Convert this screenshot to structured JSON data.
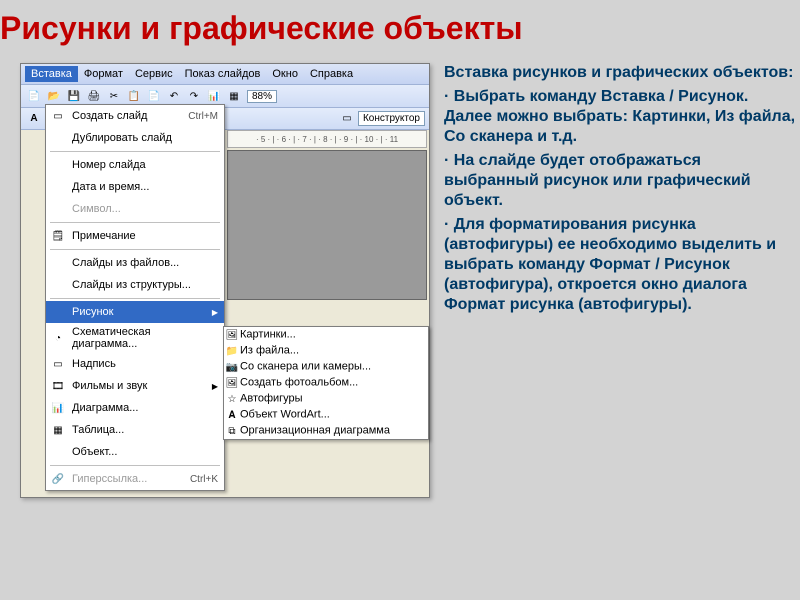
{
  "title": "Рисунки и графические объекты",
  "menubar": {
    "items": [
      "Вставка",
      "Формат",
      "Сервис",
      "Показ слайдов",
      "Окно",
      "Справка"
    ],
    "active": "Вставка"
  },
  "toolbar": {
    "zoom": "88%",
    "konstruktor": "Конструктор"
  },
  "ruler": "· 5 · | · 6 · | · 7 · | · 8 · | · 9 · | · 10 · | · 11",
  "menu": {
    "items": [
      {
        "label": "Создать слайд",
        "shortcut": "Ctrl+M",
        "icon": "new-slide-icon"
      },
      {
        "label": "Дублировать слайд"
      },
      {
        "sep": true
      },
      {
        "label": "Номер слайда"
      },
      {
        "label": "Дата и время..."
      },
      {
        "label": "Символ...",
        "disabled": true
      },
      {
        "sep": true
      },
      {
        "label": "Примечание",
        "icon": "note-icon"
      },
      {
        "sep": true
      },
      {
        "label": "Слайды из файлов..."
      },
      {
        "label": "Слайды из структуры..."
      },
      {
        "sep": true
      },
      {
        "label": "Рисунок",
        "highlight": true,
        "arrow": true
      },
      {
        "label": "Схематическая диаграмма...",
        "icon": "diagram-icon"
      },
      {
        "label": "Надпись",
        "icon": "textbox-icon"
      },
      {
        "label": "Фильмы и звук",
        "arrow": true,
        "icon": "media-icon"
      },
      {
        "label": "Диаграмма...",
        "icon": "chart-icon"
      },
      {
        "label": "Таблица...",
        "icon": "table-icon"
      },
      {
        "label": "Объект..."
      },
      {
        "sep": true
      },
      {
        "label": "Гиперссылка...",
        "shortcut": "Ctrl+K",
        "disabled": true,
        "icon": "link-icon"
      }
    ]
  },
  "submenu": {
    "items": [
      {
        "label": "Картинки...",
        "icon": "clipart-icon"
      },
      {
        "label": "Из файла...",
        "highlight": true,
        "icon": "from-file-icon"
      },
      {
        "label": "Со сканера или камеры...",
        "icon": "scanner-icon"
      },
      {
        "label": "Создать фотоальбом...",
        "icon": "photoalbum-icon"
      },
      {
        "sep": true
      },
      {
        "label": "Автофигуры",
        "icon": "autofig-icon"
      },
      {
        "label": "Объект WordArt...",
        "icon": "wordart-icon"
      },
      {
        "label": "Организационная диаграмма",
        "icon": "orgchart-icon"
      }
    ]
  },
  "description": {
    "heading": "Вставка рисунков и графических объектов:",
    "bullets": [
      "·  Выбрать команду Вставка / Рисунок. Далее можно выбрать: Картинки, Из файла, Со сканера и т.д.",
      "·  На слайде будет отображаться выбранный рисунок или графический объект.",
      "·   Для форматирования рисунка (автофигуры) ее необходимо выделить и выбрать команду Формат / Рисунок (автофигура), откроется окно диалога Формат рисунка (автофигуры)."
    ]
  }
}
